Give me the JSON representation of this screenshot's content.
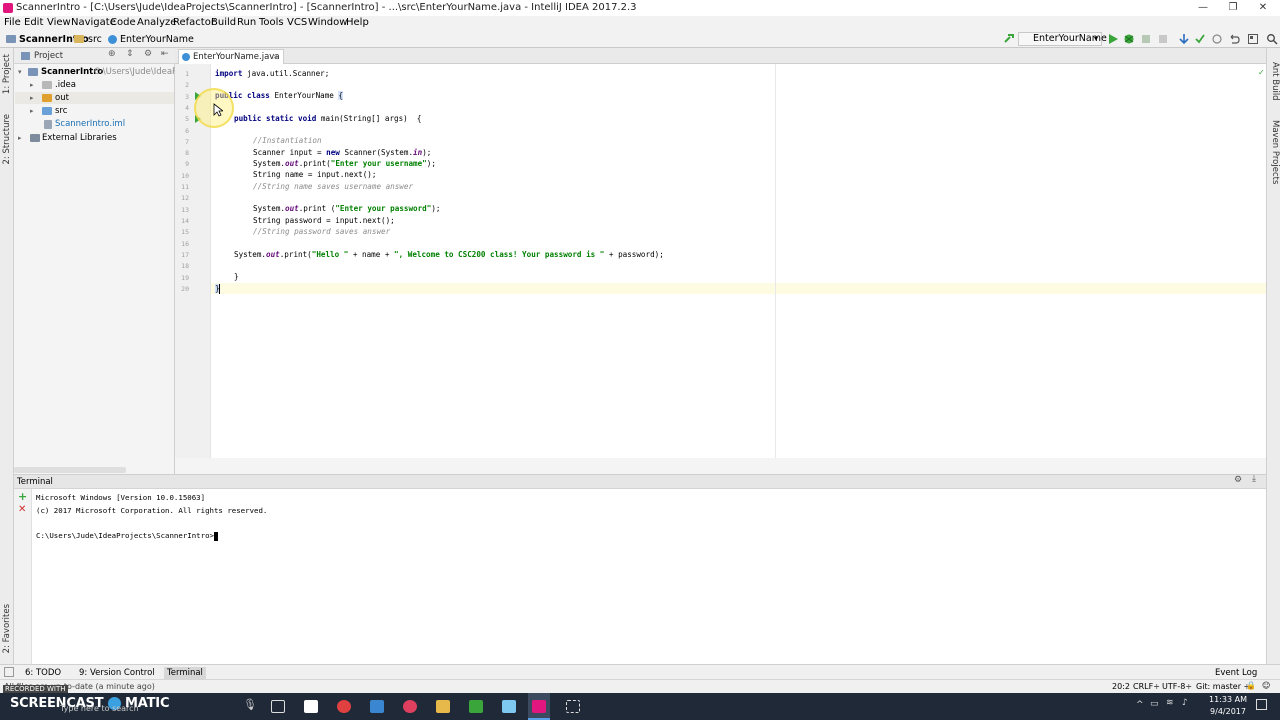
{
  "window": {
    "title": "ScannerIntro - [C:\\Users\\Jude\\IdeaProjects\\ScannerIntro] - [ScannerIntro] - ...\\src\\EnterYourName.java - IntelliJ IDEA 2017.2.3",
    "minimize": "—",
    "maximize": "❐",
    "close": "✕"
  },
  "menu": [
    "File",
    "Edit",
    "View",
    "Navigate",
    "Code",
    "Analyze",
    "Refactor",
    "Build",
    "Run",
    "Tools",
    "VCS",
    "Window",
    "Help"
  ],
  "breadcrumb": [
    "ScannerIntro",
    "src",
    "EnterYourName"
  ],
  "run_config": "EnterYourName",
  "left_strip": [
    "1: Project",
    "2: Structure",
    "2: Favorites"
  ],
  "right_strip": [
    "Ant Build",
    "Maven Projects"
  ],
  "project_panel": {
    "title": "Project",
    "root": "ScannerIntro",
    "root_path": "C:\\Users\\Jude\\IdeaProj",
    "items": [
      ".idea",
      "out",
      "src",
      "ScannerIntro.iml"
    ],
    "external": "External Libraries"
  },
  "editor_tab": "EnterYourName.java",
  "line_numbers": [
    "1",
    "2",
    "3",
    "4",
    "5",
    "6",
    "7",
    "8",
    "9",
    "10",
    "11",
    "12",
    "13",
    "14",
    "15",
    "16",
    "17",
    "18",
    "19",
    "20"
  ],
  "code": {
    "l1_kw": "import",
    "l1_rest": " java.util.Scanner;",
    "l3_kw": "public class",
    "l3_rest": " EnterYourName ",
    "l3_brace": "{",
    "l5_kw": "public static void",
    "l5_rest": " main(String[] args)  {",
    "l7_cm": "//Instantiation",
    "l8_a": "Scanner input = ",
    "l8_kw": "new",
    "l8_b": " Scanner(System.",
    "l8_fld": "in",
    "l8_c": ");",
    "l9_a": "System.",
    "l9_fld": "out",
    "l9_b": ".print(",
    "l9_str": "\"Enter your username\"",
    "l9_c": ");",
    "l10": "String name = input.next();",
    "l11_cm": "//String name saves username answer",
    "l13_a": "System.",
    "l13_fld": "out",
    "l13_b": ".print (",
    "l13_str": "\"Enter your password\"",
    "l13_c": ");",
    "l14": "String password = input.next();",
    "l15_cm": "//String password saves answer",
    "l17_a": "System.",
    "l17_fld": "out",
    "l17_b": ".print(",
    "l17_str1": "\"Hello \"",
    "l17_c": " + name + ",
    "l17_str2": "\", Welcome to CSC200 class! Your password is \"",
    "l17_d": " + password);",
    "l19": "}",
    "l20": "}"
  },
  "terminal": {
    "title": "Terminal",
    "lines": [
      "Microsoft Windows [Version 10.0.15063]",
      "(c) 2017 Microsoft Corporation. All rights reserved.",
      "",
      "C:\\Users\\Jude\\IdeaProjects\\ScannerIntro>"
    ]
  },
  "toolwindows": {
    "todo": "6: TODO",
    "vcs": "9: Version Control",
    "terminal": "Terminal",
    "event_log": "Event Log"
  },
  "status": {
    "message": "All files are up-to-date (a minute ago)",
    "position": "20:2",
    "line_sep": "CRLF÷",
    "encoding": "UTF-8÷",
    "git": "Git: master ÷"
  },
  "taskbar": {
    "search_placeholder": "Type here to search",
    "watermark": "SCREENCAST",
    "watermark2": "MATIC",
    "recorded": "RECORDED WITH",
    "time": "11:33 AM",
    "date": "9/4/2017"
  },
  "colors": {
    "keyword": "#000080",
    "string": "#008000",
    "comment": "#8c8c8c",
    "field": "#660e7a",
    "run_green": "#3aa53a",
    "accent_blue": "#2a6ebd"
  }
}
